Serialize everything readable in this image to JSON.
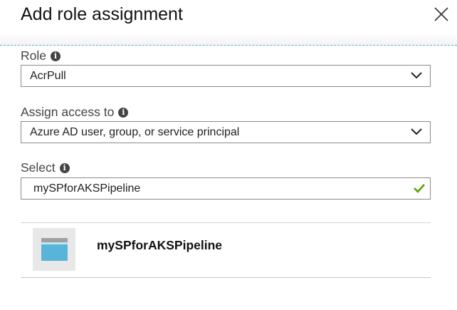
{
  "blade": {
    "title": "Add role assignment"
  },
  "role": {
    "label": "Role",
    "value": "AcrPull"
  },
  "assign_access": {
    "label": "Assign access to",
    "value": "Azure AD user, group, or service principal"
  },
  "select": {
    "label": "Select",
    "value": "mySPforAKSPipeline"
  },
  "results": [
    {
      "name": "mySPforAKSPipeline",
      "icon": "application-icon"
    }
  ],
  "colors": {
    "divider": "#59b4d9",
    "check": "#57a300",
    "app_icon_fill": "#59b4d9",
    "app_icon_bar": "#a0a0a0"
  }
}
